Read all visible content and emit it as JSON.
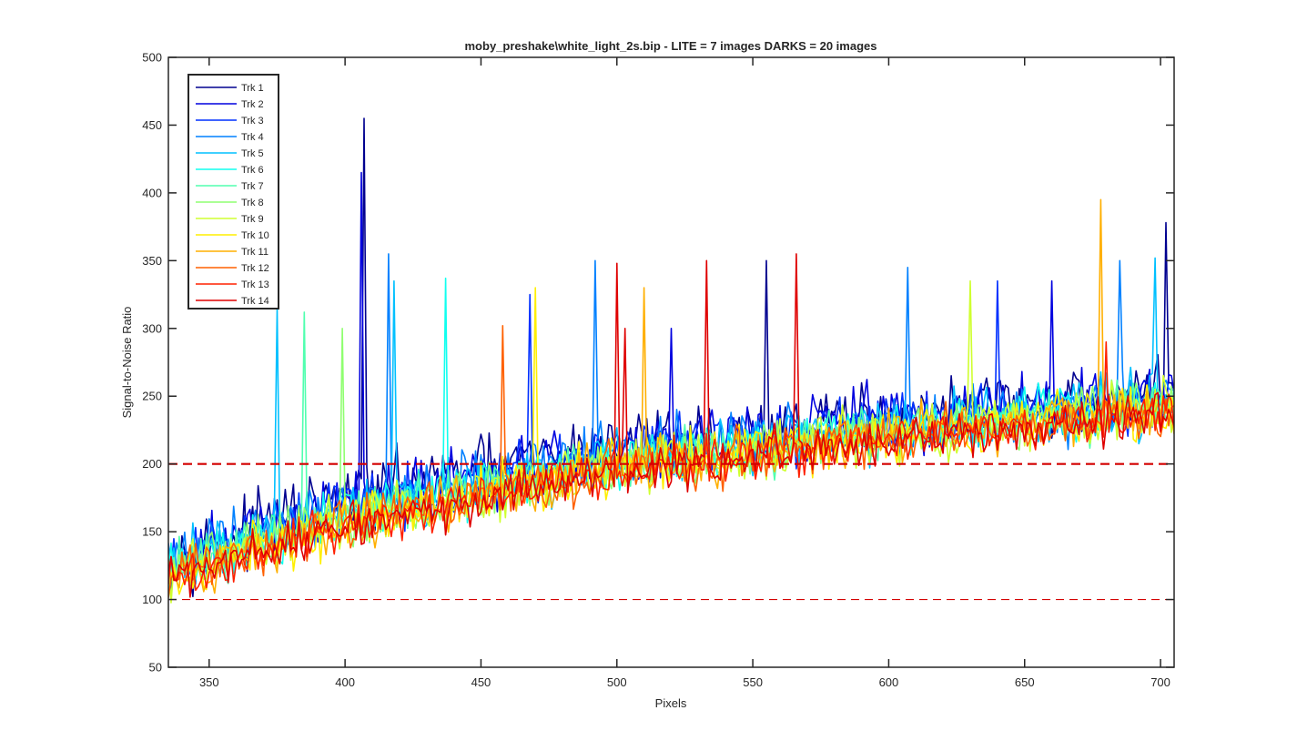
{
  "chart_data": {
    "type": "line",
    "title": "moby_preshake\\white_light_2s.bip - LITE =  7 images  DARKS = 20 images",
    "xlabel": "Pixels",
    "ylabel": "Signal-to-Noise Ratio",
    "xlim": [
      335,
      705
    ],
    "ylim": [
      50,
      500
    ],
    "xticks": [
      350,
      400,
      450,
      500,
      550,
      600,
      650,
      700
    ],
    "yticks": [
      50,
      100,
      150,
      200,
      250,
      300,
      350,
      400,
      450,
      500
    ],
    "grid": false,
    "legend_position": "top-left",
    "x_range": {
      "start": 335,
      "end": 705,
      "step": 1
    },
    "series": [
      {
        "name": "Trk 1",
        "color": "#00008f",
        "trend": [
          [
            335,
            130
          ],
          [
            400,
            175
          ],
          [
            500,
            215
          ],
          [
            600,
            235
          ],
          [
            705,
            255
          ]
        ],
        "spread": 35,
        "peaks": [
          [
            407,
            455
          ],
          [
            555,
            350
          ],
          [
            702,
            378
          ]
        ]
      },
      {
        "name": "Trk 2",
        "color": "#0000df",
        "trend": [
          [
            335,
            128
          ],
          [
            400,
            172
          ],
          [
            500,
            212
          ],
          [
            600,
            232
          ],
          [
            705,
            252
          ]
        ],
        "spread": 35,
        "peaks": [
          [
            406,
            415
          ],
          [
            520,
            300
          ],
          [
            660,
            335
          ]
        ]
      },
      {
        "name": "Trk 3",
        "color": "#0030ff",
        "trend": [
          [
            335,
            125
          ],
          [
            400,
            170
          ],
          [
            500,
            210
          ],
          [
            600,
            230
          ],
          [
            705,
            250
          ]
        ],
        "spread": 33,
        "peaks": [
          [
            468,
            325
          ],
          [
            640,
            335
          ]
        ]
      },
      {
        "name": "Trk 4",
        "color": "#0080ff",
        "trend": [
          [
            335,
            125
          ],
          [
            400,
            168
          ],
          [
            500,
            208
          ],
          [
            600,
            228
          ],
          [
            705,
            248
          ]
        ],
        "spread": 33,
        "peaks": [
          [
            416,
            355
          ],
          [
            492,
            350
          ],
          [
            607,
            345
          ],
          [
            685,
            350
          ]
        ]
      },
      {
        "name": "Trk 5",
        "color": "#00c0ff",
        "trend": [
          [
            335,
            122
          ],
          [
            400,
            165
          ],
          [
            500,
            205
          ],
          [
            600,
            226
          ],
          [
            705,
            246
          ]
        ],
        "spread": 33,
        "peaks": [
          [
            375,
            315
          ],
          [
            418,
            335
          ],
          [
            698,
            352
          ]
        ]
      },
      {
        "name": "Trk 6",
        "color": "#10ffef",
        "trend": [
          [
            335,
            122
          ],
          [
            400,
            163
          ],
          [
            500,
            203
          ],
          [
            600,
            225
          ],
          [
            705,
            245
          ]
        ],
        "spread": 30,
        "peaks": [
          [
            437,
            337
          ]
        ]
      },
      {
        "name": "Trk 7",
        "color": "#50ffaf",
        "trend": [
          [
            335,
            120
          ],
          [
            400,
            162
          ],
          [
            500,
            202
          ],
          [
            600,
            224
          ],
          [
            705,
            244
          ]
        ],
        "spread": 30,
        "peaks": [
          [
            385,
            312
          ]
        ]
      },
      {
        "name": "Trk 8",
        "color": "#8fff70",
        "trend": [
          [
            335,
            120
          ],
          [
            400,
            160
          ],
          [
            500,
            200
          ],
          [
            600,
            223
          ],
          [
            705,
            243
          ]
        ],
        "spread": 30,
        "peaks": [
          [
            399,
            300
          ]
        ]
      },
      {
        "name": "Trk 9",
        "color": "#cfff30",
        "trend": [
          [
            335,
            118
          ],
          [
            400,
            158
          ],
          [
            500,
            198
          ],
          [
            600,
            222
          ],
          [
            705,
            242
          ]
        ],
        "spread": 30,
        "peaks": [
          [
            630,
            335
          ]
        ]
      },
      {
        "name": "Trk 10",
        "color": "#ffef00",
        "trend": [
          [
            335,
            118
          ],
          [
            400,
            157
          ],
          [
            500,
            197
          ],
          [
            600,
            221
          ],
          [
            705,
            241
          ]
        ],
        "spread": 30,
        "peaks": [
          [
            470,
            330
          ]
        ]
      },
      {
        "name": "Trk 11",
        "color": "#ffaf00",
        "trend": [
          [
            335,
            116
          ],
          [
            400,
            156
          ],
          [
            500,
            196
          ],
          [
            600,
            220
          ],
          [
            705,
            240
          ]
        ],
        "spread": 30,
        "peaks": [
          [
            678,
            395
          ],
          [
            510,
            330
          ]
        ]
      },
      {
        "name": "Trk 12",
        "color": "#ff6000",
        "trend": [
          [
            335,
            116
          ],
          [
            400,
            155
          ],
          [
            500,
            195
          ],
          [
            600,
            219
          ],
          [
            705,
            239
          ]
        ],
        "spread": 28,
        "peaks": [
          [
            458,
            302
          ]
        ]
      },
      {
        "name": "Trk 13",
        "color": "#ff2000",
        "trend": [
          [
            335,
            115
          ],
          [
            400,
            154
          ],
          [
            500,
            194
          ],
          [
            600,
            218
          ],
          [
            705,
            238
          ]
        ],
        "spread": 25,
        "peaks": [
          [
            680,
            290
          ]
        ]
      },
      {
        "name": "Trk 14",
        "color": "#df0000",
        "trend": [
          [
            335,
            115
          ],
          [
            400,
            153
          ],
          [
            500,
            193
          ],
          [
            600,
            217
          ],
          [
            705,
            237
          ]
        ],
        "spread": 25,
        "peaks": [
          [
            500,
            348
          ],
          [
            533,
            350
          ],
          [
            566,
            355
          ],
          [
            503,
            300
          ]
        ]
      }
    ],
    "reference_lines": [
      {
        "y": 200,
        "style": "dashed",
        "width": "thick",
        "color": "#d40000"
      },
      {
        "y": 100,
        "style": "dashed",
        "width": "thin",
        "color": "#d40000"
      }
    ]
  }
}
